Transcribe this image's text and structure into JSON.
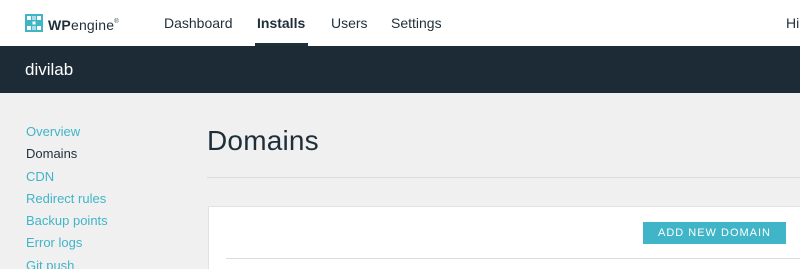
{
  "brand": {
    "logo_bold": "WP",
    "logo_rest": "engine",
    "accent": "#40b5c8",
    "dark": "#1c2b36"
  },
  "topnav": {
    "items": [
      {
        "label": "Dashboard"
      },
      {
        "label": "Installs",
        "active": true
      },
      {
        "label": "Users"
      },
      {
        "label": "Settings"
      }
    ],
    "greeting": "Hi"
  },
  "site": {
    "name": "divilab"
  },
  "sidebar": {
    "items": [
      {
        "label": "Overview"
      },
      {
        "label": "Domains",
        "current": true
      },
      {
        "label": "CDN"
      },
      {
        "label": "Redirect rules"
      },
      {
        "label": "Backup points"
      },
      {
        "label": "Error logs"
      },
      {
        "label": "Git push"
      }
    ]
  },
  "main": {
    "title": "Domains",
    "add_button": "ADD NEW DOMAIN"
  }
}
